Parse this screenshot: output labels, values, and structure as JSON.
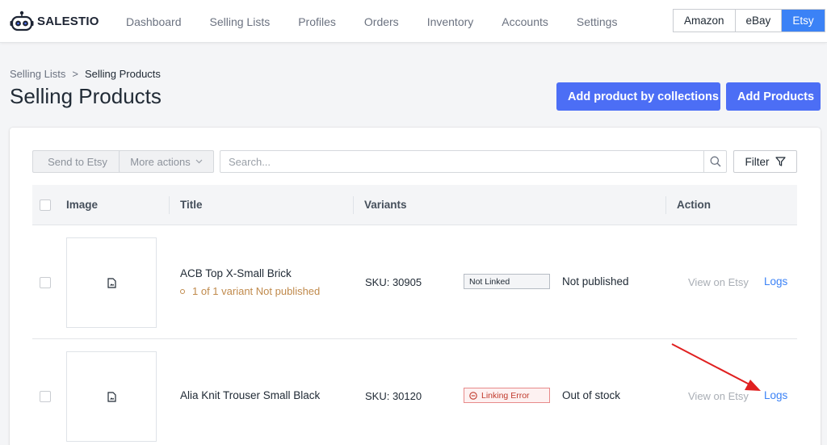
{
  "brand": {
    "name": "SALESTIO"
  },
  "nav": {
    "items": [
      {
        "label": "Dashboard"
      },
      {
        "label": "Selling Lists"
      },
      {
        "label": "Profiles"
      },
      {
        "label": "Orders"
      },
      {
        "label": "Inventory"
      },
      {
        "label": "Accounts"
      },
      {
        "label": "Settings"
      }
    ]
  },
  "marketplaces": {
    "items": [
      {
        "label": "Amazon"
      },
      {
        "label": "eBay"
      },
      {
        "label": "Etsy"
      }
    ],
    "active": "Etsy"
  },
  "breadcrumb": {
    "parent": "Selling Lists",
    "separator": ">",
    "current": "Selling Products"
  },
  "page": {
    "title": "Selling Products",
    "add_by_collections_label": "Add product by collections",
    "add_products_label": "Add Products"
  },
  "toolbar": {
    "send_label": "Send to Etsy",
    "more_actions_label": "More actions",
    "search_placeholder": "Search...",
    "filter_label": "Filter"
  },
  "table": {
    "columns": [
      {
        "label": "Image"
      },
      {
        "label": "Title"
      },
      {
        "label": "Variants"
      },
      {
        "label": "Action"
      }
    ],
    "rows": [
      {
        "title": "ACB Top X-Small Brick",
        "warning": "1 of 1 variant Not published",
        "sku": "SKU: 30905",
        "link_status": "Not Linked",
        "publish_status": "Not published",
        "view_label": "View on Etsy",
        "logs_label": "Logs"
      },
      {
        "title": "Alia Knit Trouser Small Black",
        "sku": "SKU: 30120",
        "link_status": "Linking Error",
        "publish_status": "Out of stock",
        "view_label": "View on Etsy",
        "logs_label": "Logs"
      }
    ]
  },
  "colors": {
    "primary": "#4c6ef5",
    "active_tab": "#3b82f6",
    "link": "#3b82f6",
    "warning": "#c08a4c",
    "error": "#c0392b",
    "annotation_arrow": "#e02020"
  }
}
